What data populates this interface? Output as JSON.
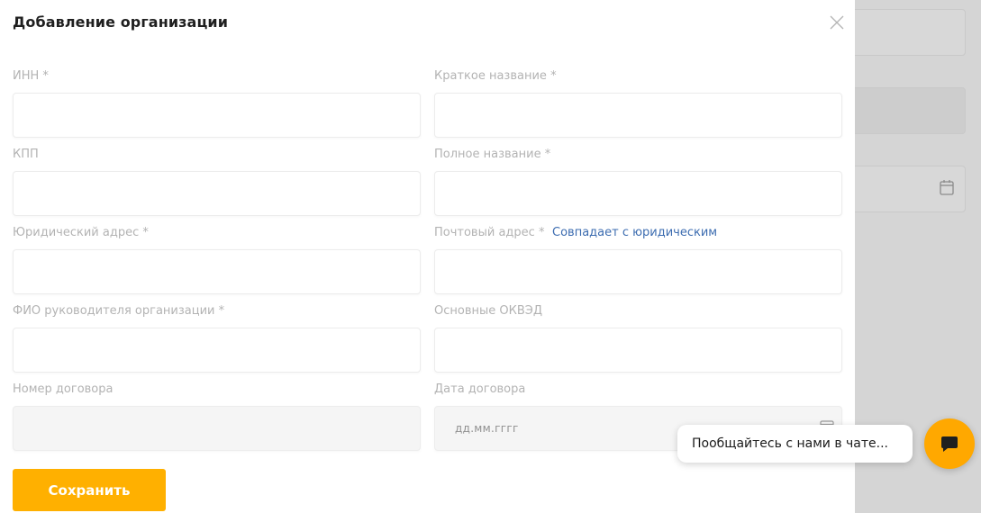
{
  "modal": {
    "title": "Добавление организации",
    "fields": {
      "inn": {
        "label": "ИНН",
        "required_mark": "*",
        "value": ""
      },
      "short_name": {
        "label": "Краткое название",
        "required_mark": "*",
        "value": ""
      },
      "kpp": {
        "label": "КПП",
        "value": ""
      },
      "full_name": {
        "label": "Полное название",
        "required_mark": "*",
        "value": ""
      },
      "legal_address": {
        "label": "Юридический адрес",
        "required_mark": "*",
        "value": ""
      },
      "postal_address": {
        "label": "Почтовый адрес",
        "required_mark": "*",
        "value": "",
        "same_as_legal_link": "Совпадает с юридическим"
      },
      "director": {
        "label": "ФИО руководителя организации",
        "required_mark": "*",
        "value": ""
      },
      "okved": {
        "label": "Основные ОКВЭД",
        "value": ""
      },
      "contract_number": {
        "label": "Номер договора",
        "value": "",
        "disabled": true
      },
      "contract_date": {
        "label": "Дата договора",
        "placeholder": "дд.мм.гггг",
        "disabled": true
      }
    },
    "save_label": "Сохранить"
  },
  "chat": {
    "bubble_text": "Пообщайтесь с нами в чате...",
    "icon": "chat-icon"
  },
  "colors": {
    "accent": "#ffb000",
    "link": "#3c6cb0",
    "label": "#b3b3b3",
    "backdrop": "#d5d5d5"
  }
}
